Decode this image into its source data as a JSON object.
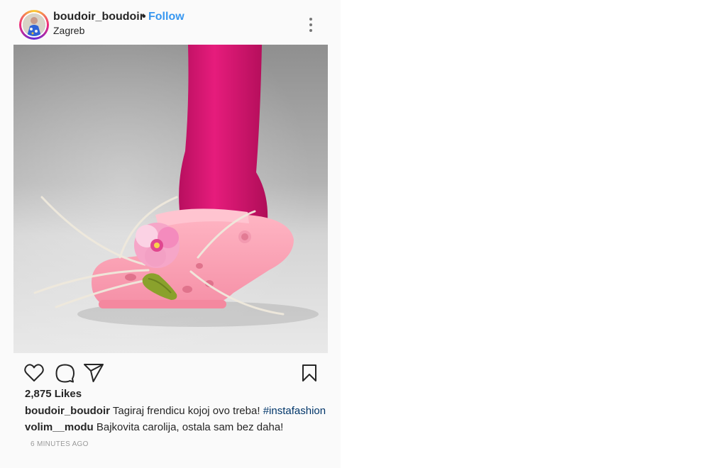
{
  "post": {
    "username": "boudoir_boudoir",
    "separator": "•",
    "follow_label": "Follow",
    "location": "Zagreb",
    "more_icon": "more-vertical-icon",
    "likes": "2,875 Likes",
    "caption": {
      "username": "boudoir_boudoir",
      "text": "Tagiraj frendicu kojoj ovo treba!",
      "hashtag": "#instafashion"
    },
    "comments": [
      {
        "username": "volim__modu",
        "text": "Bajkovita carolija, ostala sam bez daha!"
      }
    ],
    "timestamp": "6 MINUTES AGO",
    "icons": [
      "heart-icon",
      "comment-icon",
      "share-icon",
      "bookmark-icon"
    ],
    "colors": {
      "follow": "#3897f0",
      "hashtag": "#003569",
      "timestamp": "#999999",
      "text": "#262626"
    }
  }
}
